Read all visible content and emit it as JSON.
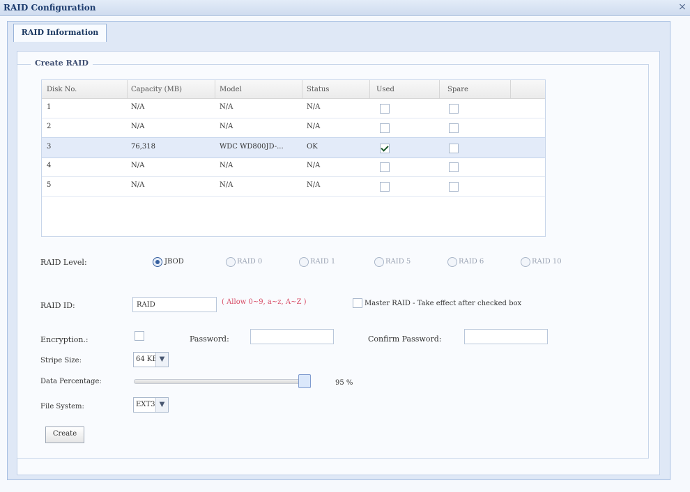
{
  "window": {
    "title": "RAID Configuration",
    "close_glyph": "×"
  },
  "tabs": [
    {
      "label": "RAID Information",
      "active": true
    }
  ],
  "create_raid": {
    "legend": "Create RAID",
    "columns": [
      "Disk No.",
      "Capacity (MB)",
      "Model",
      "Status",
      "Used",
      "Spare"
    ],
    "rows": [
      {
        "disk": "1",
        "capacity": "N/A",
        "model": "N/A",
        "status": "N/A",
        "used": false,
        "spare": false
      },
      {
        "disk": "2",
        "capacity": "N/A",
        "model": "N/A",
        "status": "N/A",
        "used": false,
        "spare": false
      },
      {
        "disk": "3",
        "capacity": "76,318",
        "model": "WDC WD800JD-...",
        "status": "OK",
        "used": true,
        "spare": false
      },
      {
        "disk": "4",
        "capacity": "N/A",
        "model": "N/A",
        "status": "N/A",
        "used": false,
        "spare": false
      },
      {
        "disk": "5",
        "capacity": "N/A",
        "model": "N/A",
        "status": "N/A",
        "used": false,
        "spare": false
      }
    ],
    "raid_level_label": "RAID Level:",
    "raid_levels": [
      {
        "label": "JBOD",
        "selected": true
      },
      {
        "label": "RAID 0",
        "selected": false
      },
      {
        "label": "RAID 1",
        "selected": false
      },
      {
        "label": "RAID 5",
        "selected": false
      },
      {
        "label": "RAID 6",
        "selected": false
      },
      {
        "label": "RAID 10",
        "selected": false
      }
    ],
    "raid_id_label": "RAID ID:",
    "raid_id_value": "RAID",
    "raid_id_hint": "( Allow 0~9, a~z, A~Z )",
    "master_raid_label": "Master RAID - Take effect after checked box",
    "encryption_label": "Encryption.:",
    "password_label": "Password:",
    "confirm_password_label": "Confirm Password:",
    "stripe_size_label": "Stripe Size:",
    "stripe_size_value": "64 KB",
    "data_percentage_label": "Data Percentage:",
    "data_percentage_value": "95 %",
    "file_system_label": "File System:",
    "file_system_value": "EXT3",
    "create_button": "Create"
  },
  "accent_colors": {
    "title": "#1d3c6e",
    "hint": "#d74a64",
    "selected_row": "#e3ebf9"
  },
  "icons": {
    "close": "close-icon",
    "dropdown": "chevron-down-icon",
    "checkbox_checked": "checkmark-icon"
  }
}
